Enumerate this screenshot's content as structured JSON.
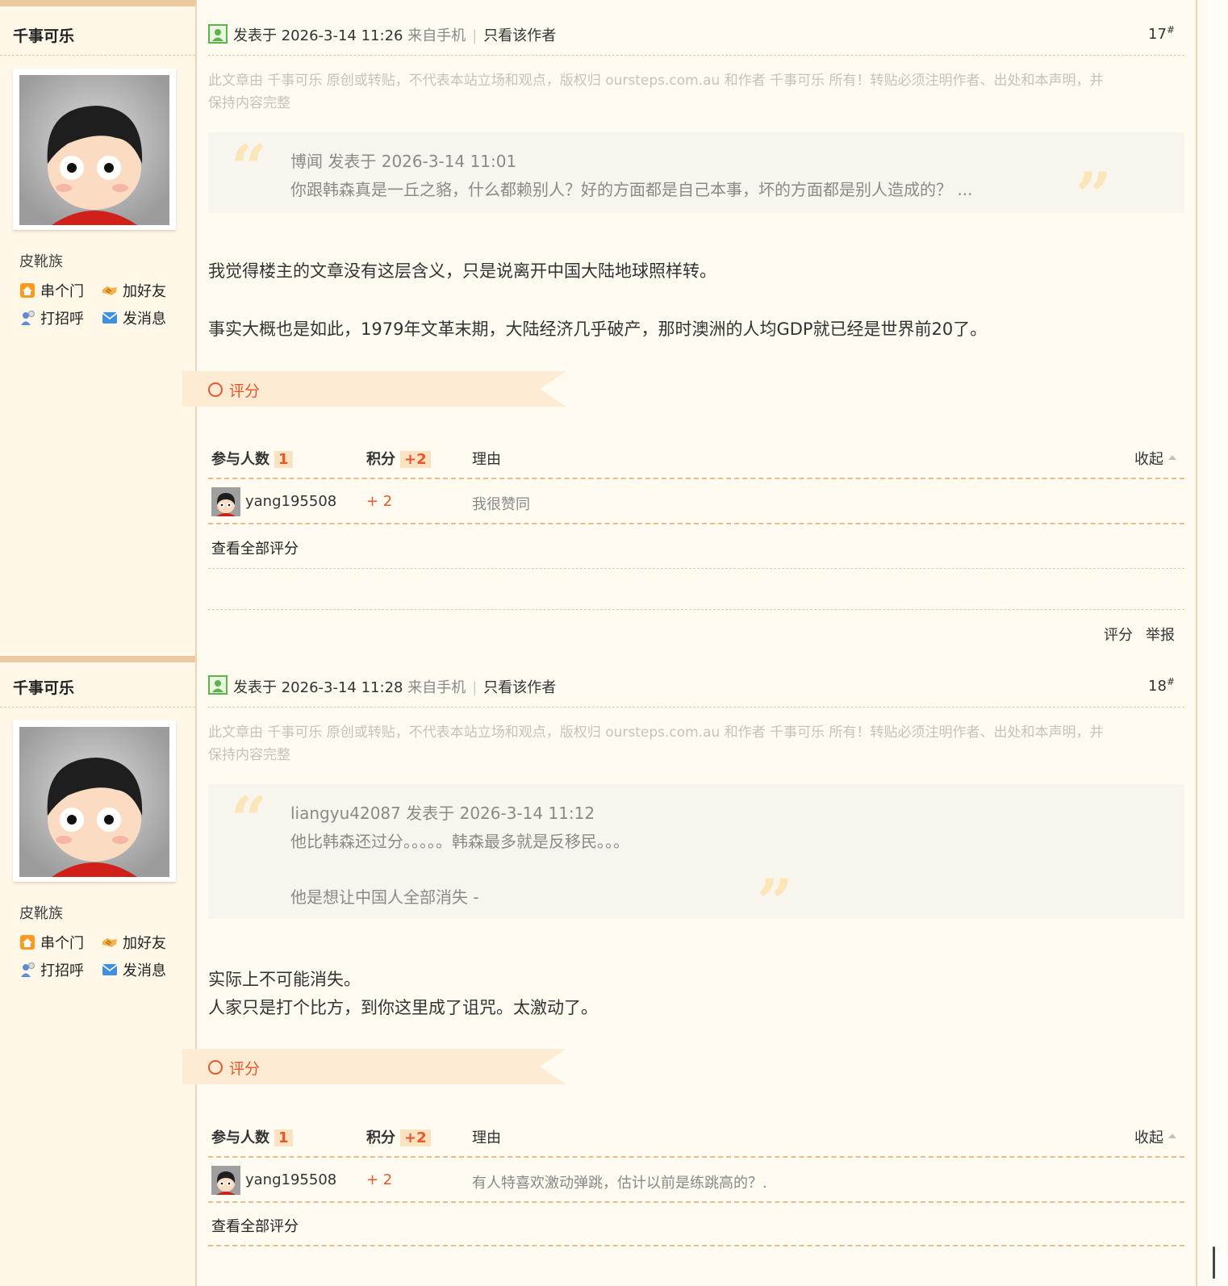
{
  "posts": [
    {
      "author": "千事可乐",
      "rank": "皮靴族",
      "actions": {
        "visit": "串个门",
        "add_friend": "加好友",
        "greet": "打招呼",
        "message": "发消息"
      },
      "posted_on": "发表于 2026-3-14 11:26",
      "from_mobile": "来自手机",
      "only_author": "只看该作者",
      "floor": "17",
      "floor_mark": "#",
      "notice_line1": "此文章由 千事可乐 原创或转贴，不代表本站立场和观点，版权归 oursteps.com.au 和作者 千事可乐 所有！转贴必须注明作者、出处和本声明，并",
      "notice_line2": "保持内容完整",
      "quote_header": "博闻 发表于 2026-3-14 11:01",
      "quote_lines": [
        "你跟韩森真是一丘之貉，什么都赖别人？好的方面都是自己本事，坏的方面都是别人造成的？ ..."
      ],
      "body_lines": [
        "我觉得楼主的文章没有这层含义，只是说离开中国大陆地球照样转。",
        "事实大概也是如此，1979年文革末期，大陆经济几乎破产，那时澳洲的人均GDP就已经是世界前20了。"
      ],
      "rating": {
        "title": "评分",
        "participants_label": "参与人数",
        "participants": "1",
        "score_label": "积分",
        "score_total": "+2",
        "reason_label": "理由",
        "collapse": "收起",
        "rows": [
          {
            "user": "yang195508",
            "score": "+ 2",
            "reason": "我很赞同"
          }
        ],
        "view_all": "查看全部评分"
      },
      "footer_actions": {
        "rate": "评分",
        "report": "举报"
      }
    },
    {
      "author": "千事可乐",
      "rank": "皮靴族",
      "actions": {
        "visit": "串个门",
        "add_friend": "加好友",
        "greet": "打招呼",
        "message": "发消息"
      },
      "posted_on": "发表于 2026-3-14 11:28",
      "from_mobile": "来自手机",
      "only_author": "只看该作者",
      "floor": "18",
      "floor_mark": "#",
      "notice_line1": "此文章由 千事可乐 原创或转贴，不代表本站立场和观点，版权归 oursteps.com.au 和作者 千事可乐 所有！转贴必须注明作者、出处和本声明，并",
      "notice_line2": "保持内容完整",
      "quote_header": "liangyu42087 发表于 2026-3-14 11:12",
      "quote_lines": [
        "他比韩森还过分。。。。。韩森最多就是反移民。。。",
        "他是想让中国人全部消失 -"
      ],
      "body_lines": [
        "实际上不可能消失。",
        "人家只是打个比方，到你这里成了诅咒。太激动了。"
      ],
      "rating": {
        "title": "评分",
        "participants_label": "参与人数",
        "participants": "1",
        "score_label": "积分",
        "score_total": "+2",
        "reason_label": "理由",
        "collapse": "收起",
        "rows": [
          {
            "user": "yang195508",
            "score": "+ 2",
            "reason": "有人特喜欢激动弹跳，估计以前是练跳高的？."
          }
        ],
        "view_all": "查看全部评分"
      }
    }
  ],
  "icons": {
    "post_icon": "online-status-icon",
    "visit": "home-icon",
    "add_friend": "handshake-icon",
    "greet": "greet-person-icon",
    "message": "envelope-icon"
  },
  "colors": {
    "accent": "#e8572b",
    "page_bg": "#fffbf1",
    "side_bg": "#fff8e9",
    "quote_bg": "#f8f5ee"
  }
}
